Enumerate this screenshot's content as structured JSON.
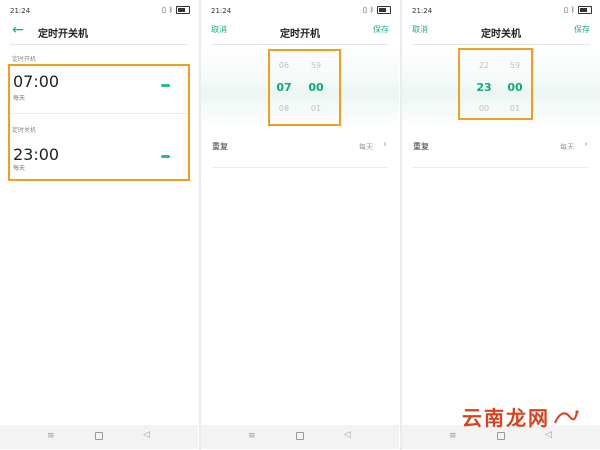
{
  "status_bar": {
    "time": "21:24"
  },
  "screen1": {
    "title": "定时开关机",
    "power_on": {
      "section_label": "定时开机",
      "time": "07:00",
      "repeat": "每天"
    },
    "power_off": {
      "section_label": "定时关机",
      "time": "23:00",
      "repeat": "每天"
    }
  },
  "screen2": {
    "title": "定时开机",
    "cancel_label": "取消",
    "save_label": "保存",
    "picker": {
      "hours": {
        "prev": "06",
        "selected": "07",
        "next": "08"
      },
      "minutes": {
        "prev": "59",
        "selected": "00",
        "next": "01"
      }
    },
    "repeat_label": "重复",
    "repeat_value": "每天"
  },
  "screen3": {
    "title": "定时关机",
    "cancel_label": "取消",
    "save_label": "保存",
    "picker": {
      "hours": {
        "prev": "22",
        "selected": "23",
        "next": "00"
      },
      "minutes": {
        "prev": "59",
        "selected": "00",
        "next": "01"
      }
    },
    "repeat_label": "重复",
    "repeat_value": "每天"
  },
  "watermark": {
    "text": "云南龙网"
  },
  "colors": {
    "accent": "#19b07a",
    "highlight": "#f0a020",
    "watermark": "#d8421c"
  },
  "icons": {
    "back": "back-arrow-icon",
    "chevron": "chevron-right-icon",
    "nav_menu": "menu-icon",
    "nav_home": "home-square-icon",
    "nav_back": "back-triangle-icon"
  }
}
